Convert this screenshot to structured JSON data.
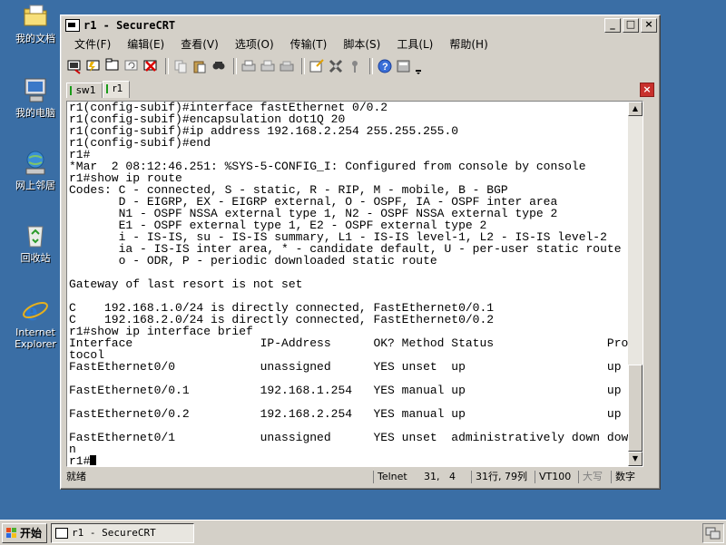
{
  "desktop": {
    "icons": [
      {
        "name": "my-documents-icon",
        "label": "我的文档"
      },
      {
        "name": "my-computer-icon",
        "label": "我的电脑"
      },
      {
        "name": "network-places-icon",
        "label": "网上邻居"
      },
      {
        "name": "recycle-bin-icon",
        "label": "回收站"
      },
      {
        "name": "internet-explorer-icon",
        "label": "Internet Explorer"
      }
    ]
  },
  "window": {
    "title": "r1 - SecureCRT",
    "controls": {
      "minimize": "_",
      "maximize": "□",
      "close": "×"
    }
  },
  "menu": [
    "文件(F)",
    "编辑(E)",
    "查看(V)",
    "选项(O)",
    "传输(T)",
    "脚本(S)",
    "工具(L)",
    "帮助(H)"
  ],
  "toolbar": {
    "icons": [
      "connect-icon",
      "quick-connect-icon",
      "connect-tab-icon",
      "reconnect-icon",
      "disconnect-icon",
      "copy-icon",
      "paste-icon",
      "find-icon",
      "print-icon",
      "print-selection-icon",
      "print-screen-icon",
      "session-options-icon",
      "global-options-icon",
      "keymap-icon",
      "help-icon",
      "sftp-icon"
    ]
  },
  "tabs": [
    {
      "label": "sw1",
      "active": false
    },
    {
      "label": "r1",
      "active": true
    }
  ],
  "terminal": {
    "lines": [
      "r1(config-subif)#interface fastEthernet 0/0.2",
      "r1(config-subif)#encapsulation dot1Q 20",
      "r1(config-subif)#ip address 192.168.2.254 255.255.255.0",
      "r1(config-subif)#end",
      "r1#",
      "*Mar  2 08:12:46.251: %SYS-5-CONFIG_I: Configured from console by console",
      "r1#show ip route",
      "Codes: C - connected, S - static, R - RIP, M - mobile, B - BGP",
      "       D - EIGRP, EX - EIGRP external, O - OSPF, IA - OSPF inter area",
      "       N1 - OSPF NSSA external type 1, N2 - OSPF NSSA external type 2",
      "       E1 - OSPF external type 1, E2 - OSPF external type 2",
      "       i - IS-IS, su - IS-IS summary, L1 - IS-IS level-1, L2 - IS-IS level-2",
      "       ia - IS-IS inter area, * - candidate default, U - per-user static route",
      "       o - ODR, P - periodic downloaded static route",
      "",
      "Gateway of last resort is not set",
      "",
      "C    192.168.1.0/24 is directly connected, FastEthernet0/0.1",
      "C    192.168.2.0/24 is directly connected, FastEthernet0/0.2",
      "r1#show ip interface brief",
      "Interface                  IP-Address      OK? Method Status                Pro",
      "tocol",
      "FastEthernet0/0            unassigned      YES unset  up                    up",
      "",
      "FastEthernet0/0.1          192.168.1.254   YES manual up                    up",
      "",
      "FastEthernet0/0.2          192.168.2.254   YES manual up                    up",
      "",
      "FastEthernet0/1            unassigned      YES unset  administratively down dow",
      "n",
      "r1#"
    ]
  },
  "statusbar": {
    "ready": "就绪",
    "protocol": "Telnet",
    "position": "31,   4",
    "rowcol": "31行, 79列",
    "emulation": "VT100",
    "caps": "大写",
    "num": "数字"
  },
  "taskbar": {
    "start": "开始",
    "task": "r1 - SecureCRT"
  }
}
